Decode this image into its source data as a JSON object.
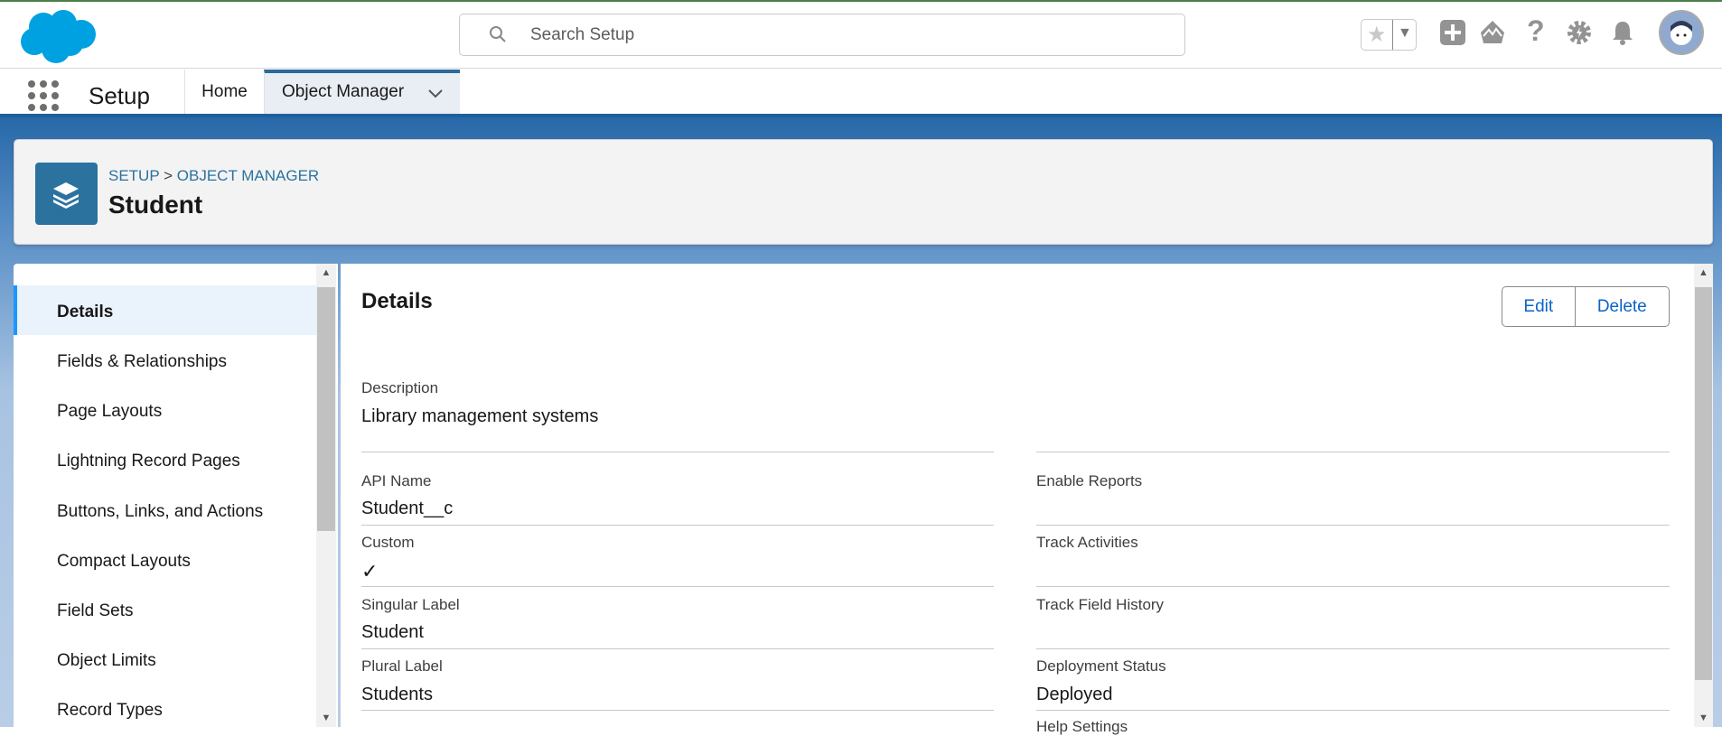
{
  "header": {
    "search_placeholder": "Search Setup"
  },
  "nav": {
    "app_name": "Setup",
    "tabs": [
      {
        "label": "Home"
      },
      {
        "label": "Object Manager"
      }
    ]
  },
  "object": {
    "breadcrumb_setup": "SETUP",
    "breadcrumb_sep": ">",
    "breadcrumb_om": "OBJECT MANAGER",
    "title": "Student"
  },
  "sidebar": {
    "items": [
      {
        "label": "Details"
      },
      {
        "label": "Fields & Relationships"
      },
      {
        "label": "Page Layouts"
      },
      {
        "label": "Lightning Record Pages"
      },
      {
        "label": "Buttons, Links, and Actions"
      },
      {
        "label": "Compact Layouts"
      },
      {
        "label": "Field Sets"
      },
      {
        "label": "Object Limits"
      },
      {
        "label": "Record Types"
      }
    ]
  },
  "details": {
    "heading": "Details",
    "edit": "Edit",
    "delete": "Delete",
    "description_label": "Description",
    "description_value": "Library management systems",
    "left": [
      {
        "label": "API Name",
        "value": "Student__c"
      },
      {
        "label": "Custom",
        "value": "✓"
      },
      {
        "label": "Singular Label",
        "value": "Student"
      },
      {
        "label": "Plural Label",
        "value": "Students"
      }
    ],
    "right": [
      {
        "label": "Enable Reports",
        "value": ""
      },
      {
        "label": "Track Activities",
        "value": ""
      },
      {
        "label": "Track Field History",
        "value": ""
      },
      {
        "label": "Deployment Status",
        "value": "Deployed"
      },
      {
        "label": "Help Settings",
        "value": ""
      }
    ]
  },
  "colors": {
    "brand": "#00a1e0",
    "accent": "#2b729f",
    "link": "#0b63c7"
  }
}
